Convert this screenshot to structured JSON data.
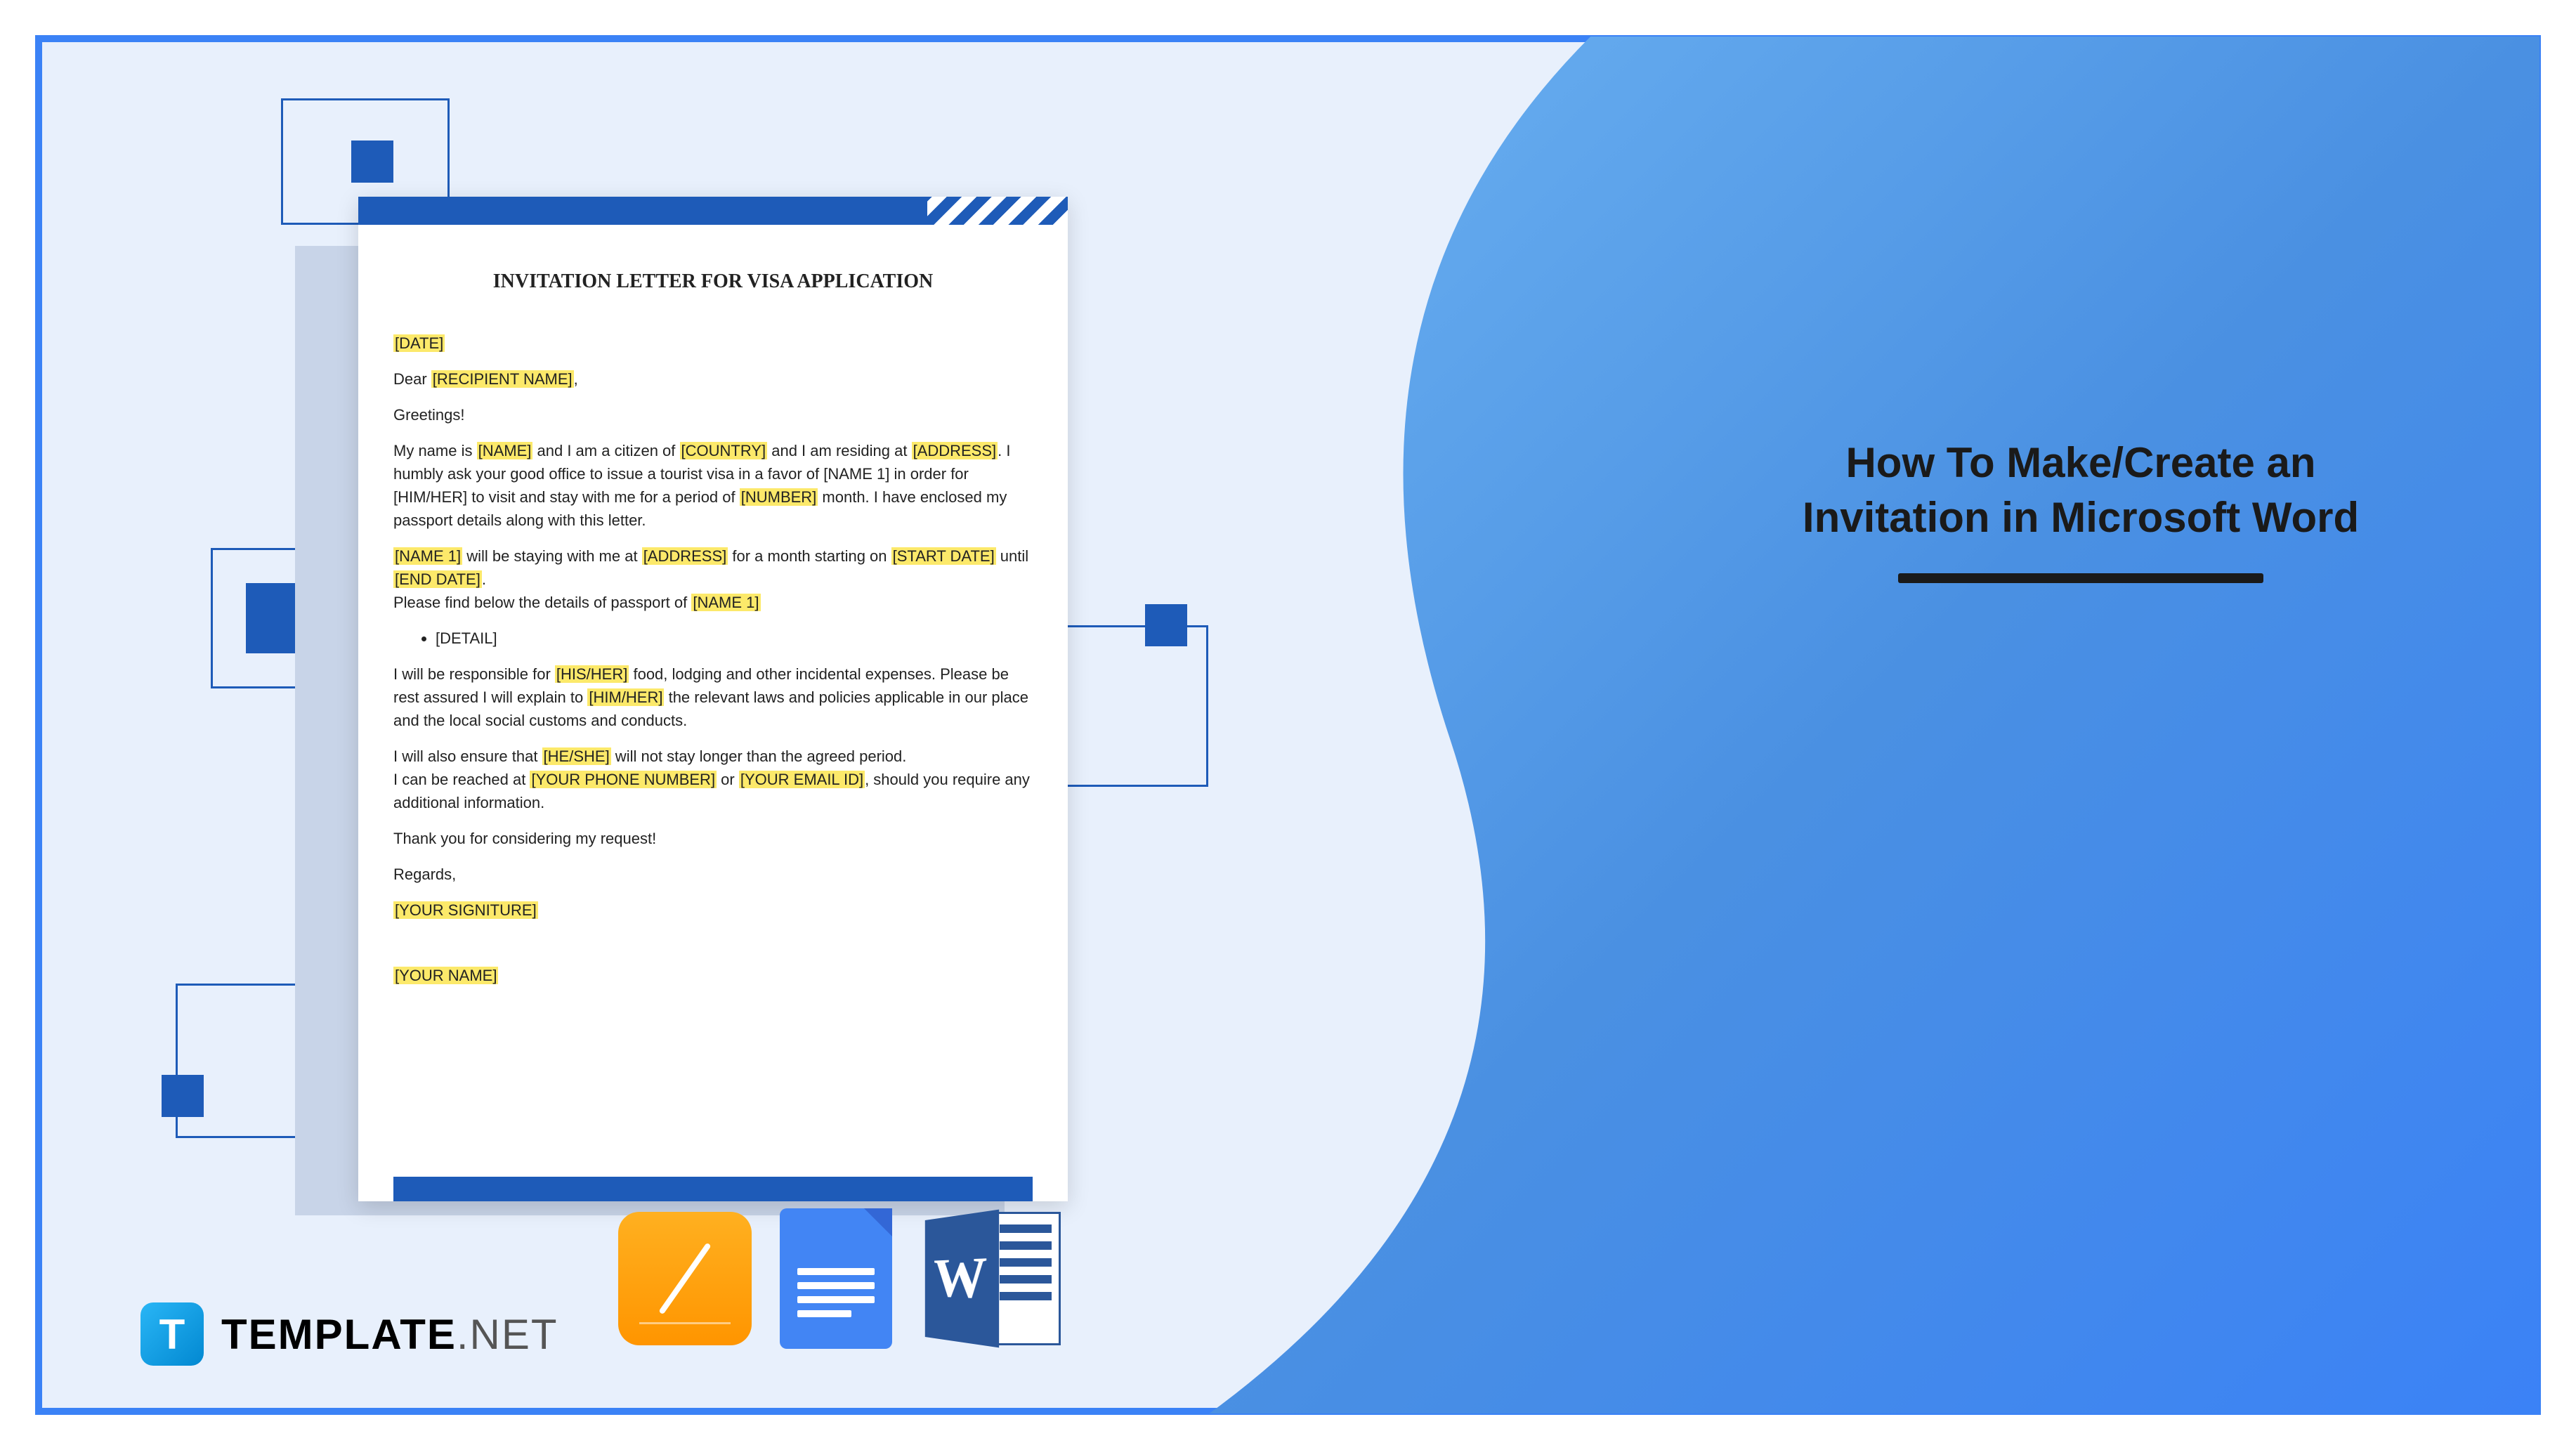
{
  "title": {
    "line1": "How To Make/Create an",
    "line2": "Invitation in Microsoft Word"
  },
  "document": {
    "heading": "INVITATION LETTER FOR VISA APPLICATION",
    "date_ph": "[DATE]",
    "recipient_prefix": "Dear ",
    "recipient_ph": "[RECIPIENT NAME]",
    "greeting": "Greetings!",
    "p1_a": "My name is ",
    "p1_name": "[NAME]",
    "p1_b": " and I am a citizen of ",
    "p1_country": "[COUNTRY]",
    "p1_c": " and I am residing at ",
    "p1_address": "[ADDRESS]",
    "p1_d": ". I humbly ask your good office to issue a tourist visa in a favor of [NAME 1] in order for [HIM/HER] to visit and stay with me for a period of ",
    "p1_number": "[NUMBER]",
    "p1_e": " month. I have enclosed my passport details along with this letter.",
    "p2_name1": "[NAME 1]",
    "p2_a": " will be staying with me at ",
    "p2_address": "[ADDRESS]",
    "p2_b": " for a month starting on ",
    "p2_start": "[START DATE]",
    "p2_c": " until ",
    "p2_end": "[END DATE]",
    "p2_d": ".",
    "p3_a": "Please find below the details of passport of ",
    "p3_name1": "[NAME 1]",
    "detail": "[DETAIL]",
    "p4_a": "I will be responsible for ",
    "p4_hisher": "[HIS/HER]",
    "p4_b": " food, lodging and other incidental expenses. Please be rest assured I will explain to ",
    "p4_himher": "[HIM/HER]",
    "p4_c": " the relevant laws and policies applicable in our place and the local social customs and conducts.",
    "p5_a": "I will also ensure that ",
    "p5_heshe": "[HE/SHE]",
    "p5_b": " will not stay longer than the agreed period.",
    "p6_a": "I can be reached at ",
    "p6_phone": "[YOUR PHONE NUMBER]",
    "p6_b": " or ",
    "p6_email": "[YOUR EMAIL ID]",
    "p6_c": ", should you require any additional information.",
    "thanks": "Thank you for considering my request!",
    "regards": "Regards,",
    "signature": "[YOUR SIGNITURE]",
    "yourname": "[YOUR NAME]"
  },
  "brand": {
    "icon_letter": "T",
    "text_main": "TEMPLATE",
    "text_suffix": ".NET"
  },
  "icons": {
    "word_letter": "W"
  }
}
